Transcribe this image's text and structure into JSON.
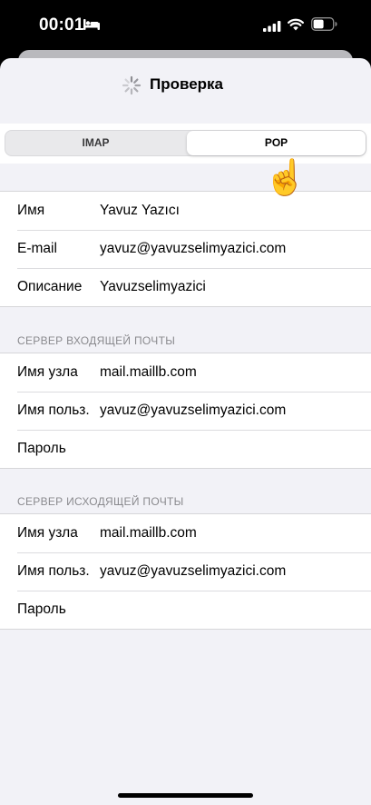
{
  "status_bar": {
    "time": "00:01",
    "icons": [
      "bed-icon",
      "cellular-signal-icon",
      "wifi-icon",
      "battery-icon"
    ]
  },
  "nav": {
    "title": "Проверка",
    "activity": "spinner-icon"
  },
  "segmented_control": {
    "options": [
      "IMAP",
      "POP"
    ],
    "selected": "POP"
  },
  "account": {
    "rows": [
      {
        "label": "Имя",
        "value": "Yavuz Yazıcı"
      },
      {
        "label": "E-mail",
        "value": "yavuz@yavuzselimyazici.com"
      },
      {
        "label": "Описание",
        "value": "Yavuzselimyazici"
      }
    ]
  },
  "incoming": {
    "header": "СЕРВЕР ВХОДЯЩЕЙ ПОЧТЫ",
    "rows": [
      {
        "label": "Имя узла",
        "value": "mail.maillb.com"
      },
      {
        "label": "Имя польз.",
        "value": "yavuz@yavuzselimyazici.com"
      },
      {
        "label": "Пароль",
        "value": ""
      }
    ]
  },
  "outgoing": {
    "header": "СЕРВЕР ИСХОДЯЩЕЙ ПОЧТЫ",
    "rows": [
      {
        "label": "Имя узла",
        "value": "mail.maillb.com"
      },
      {
        "label": "Имя польз.",
        "value": "yavuz@yavuzselimyazici.com"
      },
      {
        "label": "Пароль",
        "value": ""
      }
    ]
  },
  "overlay": {
    "pointer": "pointing-hand-icon"
  },
  "colors": {
    "background": "#f2f2f7",
    "cell": "#ffffff",
    "secondary_text": "#8a8a8e"
  }
}
